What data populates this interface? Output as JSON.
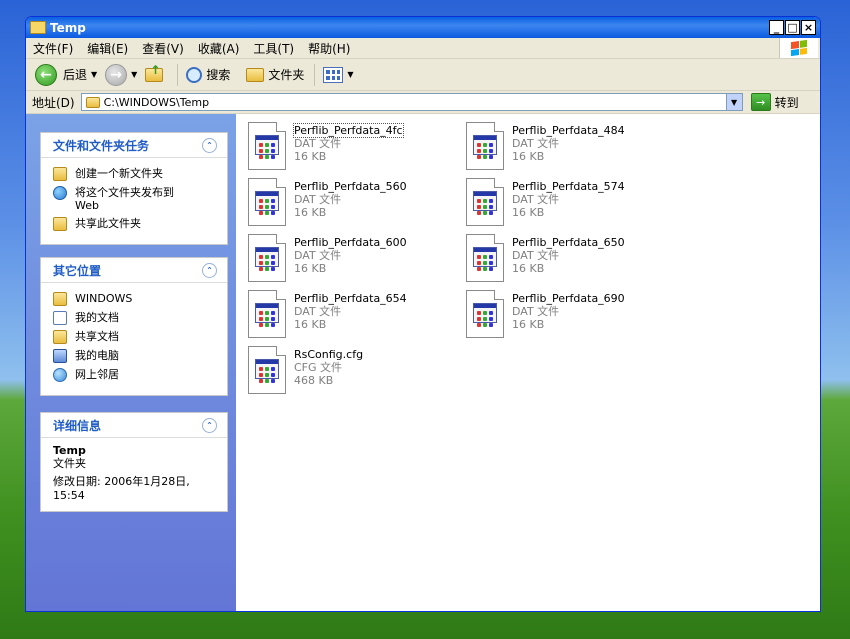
{
  "window": {
    "title": "Temp"
  },
  "menu": [
    "文件(F)",
    "编辑(E)",
    "查看(V)",
    "收藏(A)",
    "工具(T)",
    "帮助(H)"
  ],
  "toolbar": {
    "back": "后退",
    "search": "搜索",
    "folders": "文件夹"
  },
  "address": {
    "label": "地址(D)",
    "path": "C:\\WINDOWS\\Temp",
    "go": "转到"
  },
  "tasks": {
    "title": "文件和文件夹任务",
    "items": [
      "创建一个新文件夹",
      "将这个文件夹发布到",
      "Web",
      "共享此文件夹"
    ]
  },
  "places": {
    "title": "其它位置",
    "items": [
      "WINDOWS",
      "我的文档",
      "共享文档",
      "我的电脑",
      "网上邻居"
    ]
  },
  "details": {
    "title": "详细信息",
    "name": "Temp",
    "type": "文件夹",
    "modified": "修改日期: 2006年1月28日,",
    "time": "15:54"
  },
  "files": [
    {
      "name": "Perflib_Perfdata_4fc",
      "type": "DAT 文件",
      "size": "16 KB"
    },
    {
      "name": "Perflib_Perfdata_484",
      "type": "DAT 文件",
      "size": "16 KB"
    },
    {
      "name": "Perflib_Perfdata_560",
      "type": "DAT 文件",
      "size": "16 KB"
    },
    {
      "name": "Perflib_Perfdata_574",
      "type": "DAT 文件",
      "size": "16 KB"
    },
    {
      "name": "Perflib_Perfdata_600",
      "type": "DAT 文件",
      "size": "16 KB"
    },
    {
      "name": "Perflib_Perfdata_650",
      "type": "DAT 文件",
      "size": "16 KB"
    },
    {
      "name": "Perflib_Perfdata_654",
      "type": "DAT 文件",
      "size": "16 KB"
    },
    {
      "name": "Perflib_Perfdata_690",
      "type": "DAT 文件",
      "size": "16 KB"
    },
    {
      "name": "RsConfig.cfg",
      "type": "CFG 文件",
      "size": "468 KB"
    }
  ]
}
